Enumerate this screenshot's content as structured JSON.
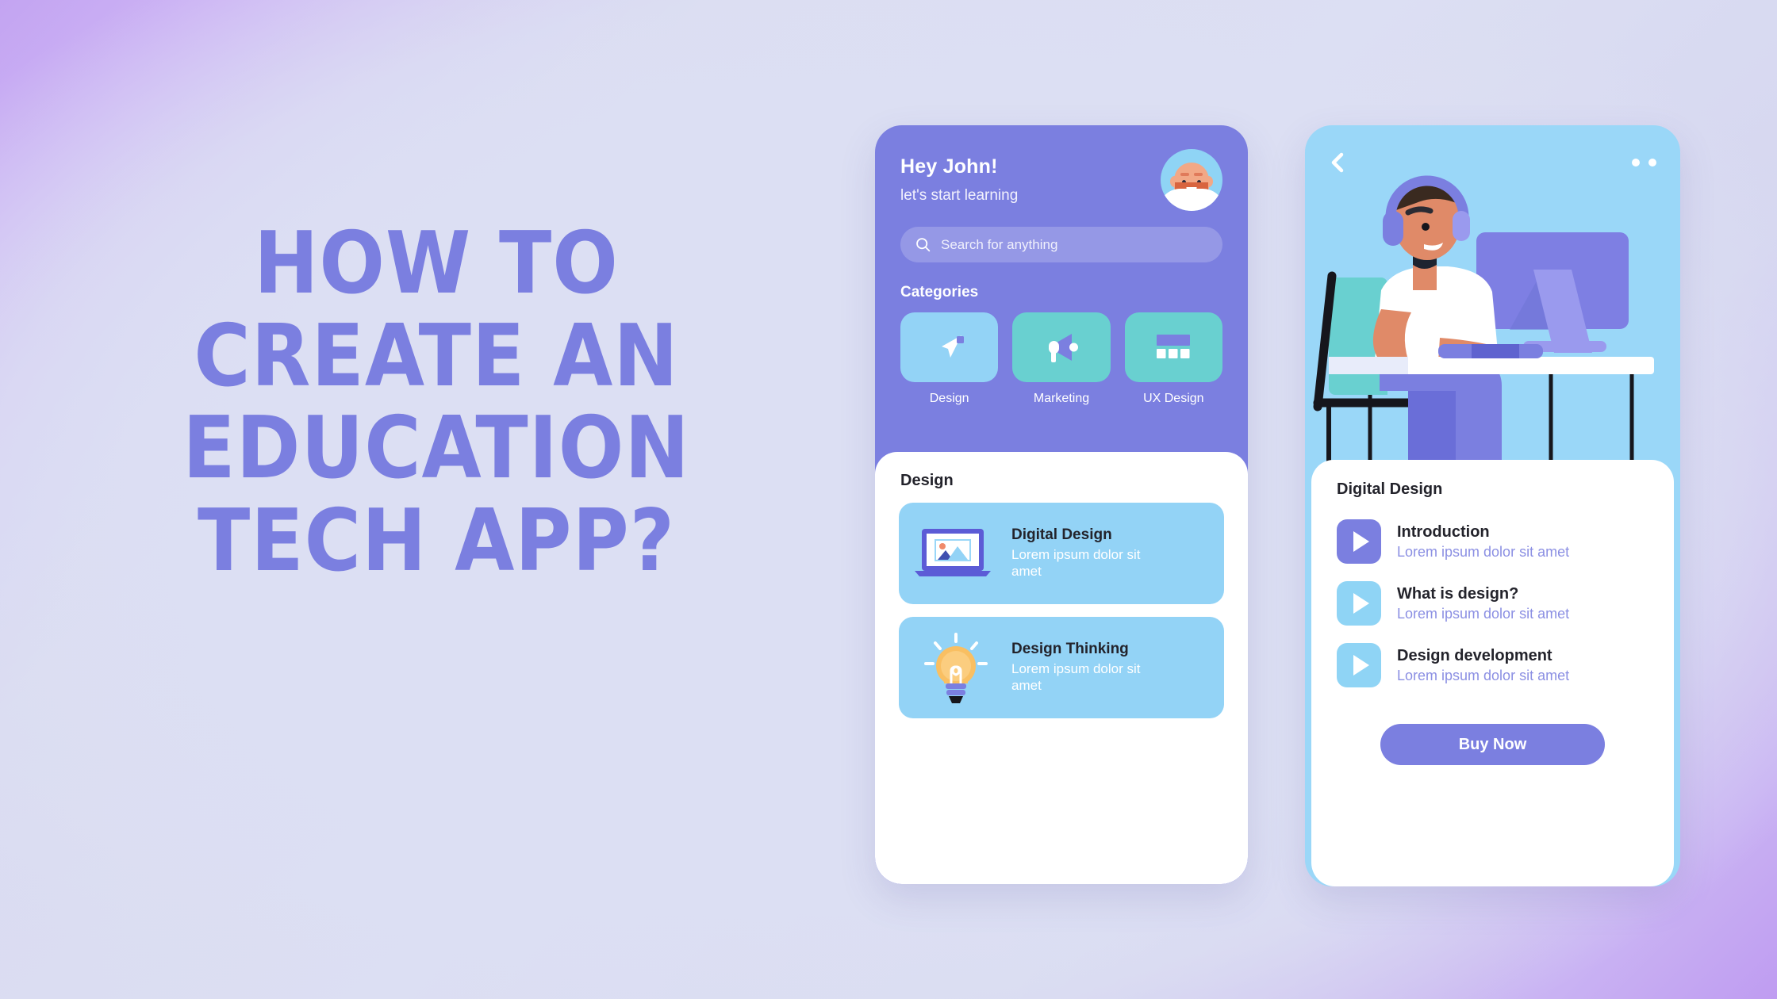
{
  "poster": {
    "headline_lines": [
      "HOW TO",
      "CREATE AN",
      "EDUCATION",
      "TECH APP?"
    ],
    "headline_color": "#7b7fe0",
    "background_colors": {
      "edge": "#c3a4f2",
      "center": "#dcdff3"
    }
  },
  "phone_home": {
    "accent": "#7b7fe0",
    "greeting": "Hey John!",
    "subgreeting": "let's start learning",
    "avatar_name": "user-avatar",
    "search": {
      "icon": "search-icon",
      "placeholder": "Search for anything",
      "value": ""
    },
    "categories_title": "Categories",
    "categories": [
      {
        "label": "Design",
        "icon": "paper-plane-icon",
        "tile_color": "#93d3f6"
      },
      {
        "label": "Marketing",
        "icon": "megaphone-icon",
        "tile_color": "#69d0d0"
      },
      {
        "label": "UX Design",
        "icon": "layout-grid-icon",
        "tile_color": "#69d0d0"
      }
    ],
    "section_title": "Design",
    "courses": [
      {
        "title": "Digital Design",
        "subtitle": "Lorem ipsum dolor sit amet",
        "icon": "laptop-image-icon",
        "card_color": "#93d3f6"
      },
      {
        "title": "Design Thinking",
        "subtitle": "Lorem ipsum dolor sit amet",
        "icon": "lightbulb-icon",
        "card_color": "#93d3f6"
      }
    ]
  },
  "phone_detail": {
    "hero_bg": "#9ad7f8",
    "back_icon": "chevron-left-icon",
    "more_icon": "more-dots-icon",
    "hero_illustration": "man-with-headphones-at-computer",
    "title": "Digital Design",
    "lessons": [
      {
        "name": "Introduction",
        "subtitle": "Lorem ipsum dolor sit amet",
        "icon": "play-icon",
        "icon_color": "#7b7fe0"
      },
      {
        "name": "What is design?",
        "subtitle": "Lorem ipsum dolor sit amet",
        "icon": "play-icon",
        "icon_color": "#8fd4f5"
      },
      {
        "name": "Design development",
        "subtitle": "Lorem ipsum dolor sit amet",
        "icon": "play-icon",
        "icon_color": "#8fd4f5"
      }
    ],
    "buy_label": "Buy Now"
  }
}
